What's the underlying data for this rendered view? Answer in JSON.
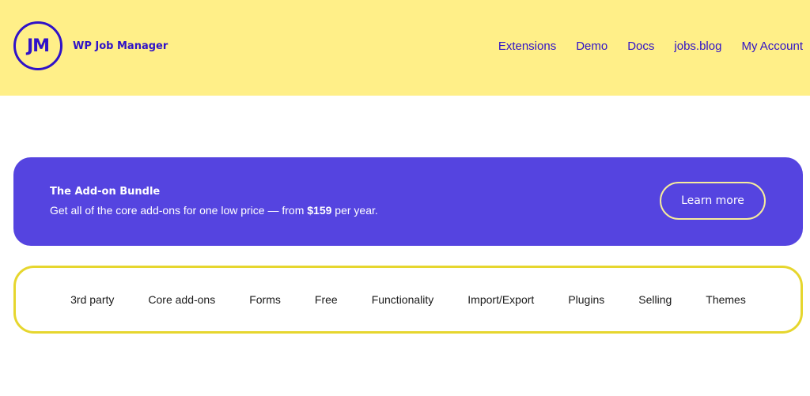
{
  "header": {
    "logo_mark": "JM",
    "logo_text": "WP Job Manager",
    "nav": [
      {
        "label": "Extensions"
      },
      {
        "label": "Demo"
      },
      {
        "label": "Docs"
      },
      {
        "label": "jobs.blog"
      },
      {
        "label": "My Account"
      }
    ]
  },
  "banner": {
    "title": "The Add-on Bundle",
    "desc_prefix": "Get all of the core add-ons for one low price — from ",
    "desc_price": "$159",
    "desc_suffix": " per year.",
    "button_label": "Learn more"
  },
  "categories": [
    {
      "label": "3rd party"
    },
    {
      "label": "Core add-ons"
    },
    {
      "label": "Forms"
    },
    {
      "label": "Free"
    },
    {
      "label": "Functionality"
    },
    {
      "label": "Import/Export"
    },
    {
      "label": "Plugins"
    },
    {
      "label": "Selling"
    },
    {
      "label": "Themes"
    }
  ],
  "colors": {
    "header_bg": "#ffef88",
    "brand": "#2f12c8",
    "banner_bg": "#5544e0",
    "category_border": "#e6d62e"
  }
}
